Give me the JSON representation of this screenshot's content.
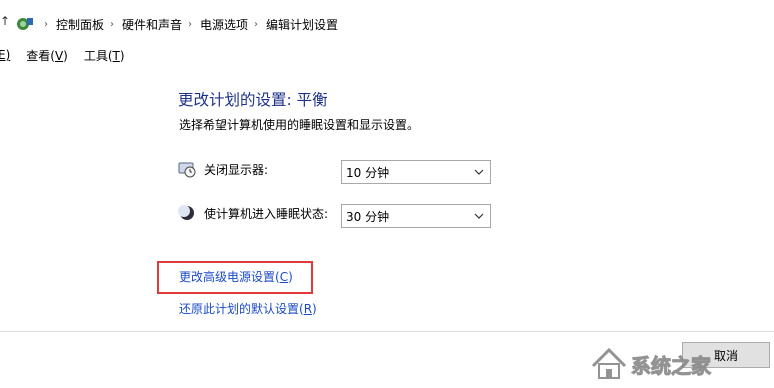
{
  "address_bar": {
    "up_arrow": "↑",
    "breadcrumbs": [
      "控制面板",
      "硬件和声音",
      "电源选项",
      "编辑计划设置"
    ]
  },
  "menu": {
    "items": [
      {
        "text": "E)",
        "label": "edit"
      },
      {
        "prefix": "查看(",
        "accel": "V",
        "suffix": ")"
      },
      {
        "prefix": "工具(",
        "accel": "T",
        "suffix": ")"
      }
    ]
  },
  "main": {
    "title": "更改计划的设置: 平衡",
    "description": "选择希望计算机使用的睡眠设置和显示设置。",
    "settings": [
      {
        "label": "关闭显示器:",
        "value": "10 分钟",
        "icon": "monitor-icon"
      },
      {
        "label": "使计算机进入睡眠状态:",
        "value": "30 分钟",
        "icon": "moon-icon"
      }
    ],
    "links": {
      "advanced": {
        "prefix": "更改高级电源设置(",
        "accel": "C",
        "suffix": ")"
      },
      "restore": {
        "prefix": "还原此计划的默认设置(",
        "accel": "R",
        "suffix": ")"
      }
    }
  },
  "buttons": {
    "cancel": "取消"
  },
  "watermark": {
    "text": "系统之家"
  },
  "colors": {
    "title": "#1e3287",
    "link": "#1a4ac6",
    "highlight_box": "#e03b3b"
  }
}
